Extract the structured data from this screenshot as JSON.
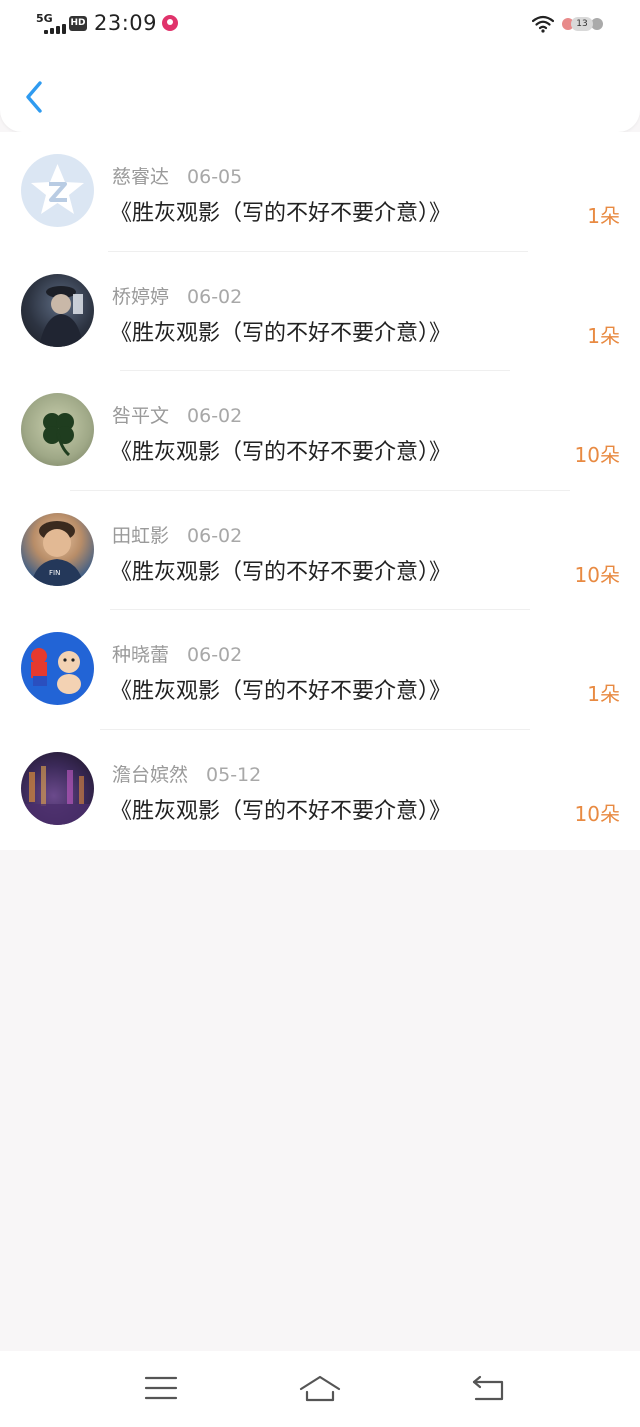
{
  "status_bar": {
    "network": "5G",
    "hd": "HD",
    "time": "23:09",
    "battery": "13"
  },
  "header": {
    "back_icon": "chevron-left-icon",
    "accent_color": "#2f9bf0"
  },
  "gifts": {
    "count_color": "#e88a42",
    "items": [
      {
        "name": "慈睿达",
        "date": "06-05",
        "title": "《胜灰观影（写的不好不要介意）》",
        "count": "1朵"
      },
      {
        "name": "桥婷婷",
        "date": "06-02",
        "title": "《胜灰观影（写的不好不要介意）》",
        "count": "1朵"
      },
      {
        "name": "咎平文",
        "date": "06-02",
        "title": "《胜灰观影（写的不好不要介意）》",
        "count": "10朵"
      },
      {
        "name": "田虹影",
        "date": "06-02",
        "title": "《胜灰观影（写的不好不要介意）》",
        "count": "10朵"
      },
      {
        "name": "种晓蕾",
        "date": "06-02",
        "title": "《胜灰观影（写的不好不要介意）》",
        "count": "1朵"
      },
      {
        "name": "澹台嫔然",
        "date": "05-12",
        "title": "《胜灰观影（写的不好不要介意）》",
        "count": "10朵"
      }
    ]
  },
  "nav": {
    "menu_icon": "menu-icon",
    "home_icon": "home-icon",
    "back_icon": "back-arrow-icon"
  }
}
